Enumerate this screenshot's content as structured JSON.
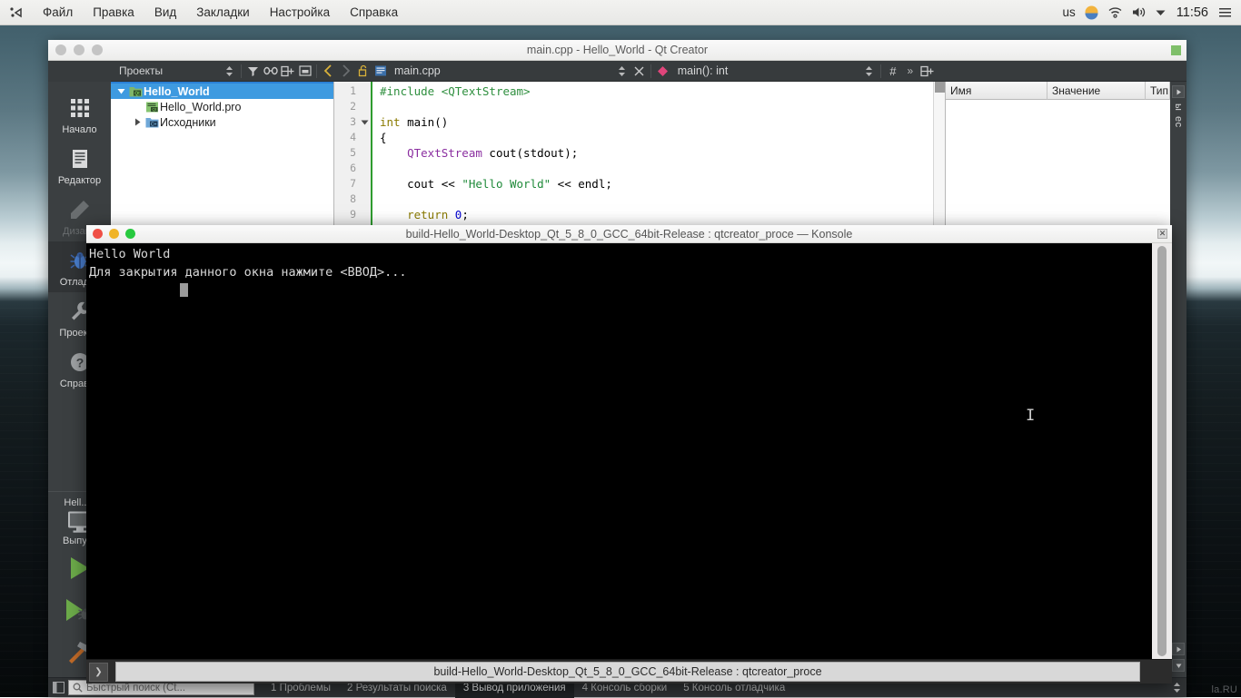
{
  "top_panel": {
    "launcher_icon": "kde-launcher-icon",
    "menus": [
      {
        "label": "Файл",
        "name": "menu-file"
      },
      {
        "label": "Правка",
        "name": "menu-edit"
      },
      {
        "label": "Вид",
        "name": "menu-view"
      },
      {
        "label": "Закладки",
        "name": "menu-bookmarks"
      },
      {
        "label": "Настройка",
        "name": "menu-settings"
      },
      {
        "label": "Справка",
        "name": "menu-help"
      }
    ],
    "tray": {
      "keyboard_layout": "us",
      "weather_icon": "weather-sun-cloud-icon",
      "network_icon": "wifi-icon",
      "volume_icon": "volume-icon",
      "expand_icon": "chevron-down-icon",
      "clock": "11:56",
      "menu_icon": "hamburger-menu-icon"
    }
  },
  "qt_creator": {
    "window_title": "main.cpp - Hello_World - Qt Creator",
    "toolbar": {
      "projects_label": "Проекты",
      "filter_icon": "filter-icon",
      "link_icon": "link-icon",
      "split_icon": "split-add-icon",
      "minimize_icon": "collapse-icon",
      "back_icon": "nav-back-icon",
      "forward_icon": "nav-forward-icon",
      "lock_icon": "unlock-icon",
      "file_type_icon": "cpp-file-icon",
      "filename": "main.cpp",
      "close_icon": "close-icon",
      "symbol_icon": "symbol-diamond-icon",
      "symbol": "main(): int",
      "line_col_icon": "line-number-icon",
      "more_icon": "overflow-icon",
      "split_editor_icon": "split-editor-icon"
    },
    "modes": [
      {
        "label": "Начало",
        "icon": "welcome-grid-icon",
        "name": "mode-welcome",
        "active": false,
        "dim": false
      },
      {
        "label": "Редактор",
        "icon": "edit-document-icon",
        "name": "mode-edit",
        "active": false,
        "dim": false
      },
      {
        "label": "Дизайн",
        "icon": "design-pencil-icon",
        "name": "mode-design",
        "active": false,
        "dim": true
      },
      {
        "label": "Отладка",
        "icon": "debug-bug-icon",
        "name": "mode-debug",
        "active": true,
        "dim": false
      },
      {
        "label": "Проекты",
        "icon": "projects-wrench-icon",
        "name": "mode-projects",
        "active": false,
        "dim": false
      },
      {
        "label": "Справка",
        "icon": "help-question-icon",
        "name": "mode-help",
        "active": false,
        "dim": false
      }
    ],
    "kit": {
      "project_name": "Hell...o",
      "build_config": "Выпуск",
      "target_icon": "desktop-monitor-icon",
      "run_icon": "run-play-icon",
      "debug_icon": "debug-play-icon",
      "build_icon": "build-hammer-icon"
    },
    "project_tree": [
      {
        "label": "Hello_World",
        "icon": "qt-project-icon",
        "indent": 0,
        "selected": true,
        "expander": "expanded"
      },
      {
        "label": "Hello_World.pro",
        "icon": "pro-file-icon",
        "indent": 1,
        "selected": false,
        "expander": "none"
      },
      {
        "label": "Исходники",
        "icon": "sources-folder-icon",
        "indent": 1,
        "selected": false,
        "expander": "collapsed"
      }
    ],
    "editor": {
      "line_numbers": [
        "1",
        "2",
        "3",
        "4",
        "5",
        "6",
        "7",
        "8",
        "9"
      ],
      "code_lines": [
        [
          {
            "t": "#include ",
            "c": "k-pre"
          },
          {
            "t": "<QTextStream>",
            "c": "k-inc"
          }
        ],
        [
          {
            "t": "",
            "c": ""
          }
        ],
        [
          {
            "t": "int",
            "c": "k-type"
          },
          {
            "t": " main()",
            "c": ""
          }
        ],
        [
          {
            "t": "{",
            "c": ""
          }
        ],
        [
          {
            "t": "    QTextStream",
            "c": "k-cls"
          },
          {
            "t": " cout(stdout);",
            "c": ""
          }
        ],
        [
          {
            "t": "",
            "c": ""
          }
        ],
        [
          {
            "t": "    cout << ",
            "c": ""
          },
          {
            "t": "\"Hello World\"",
            "c": "k-str"
          },
          {
            "t": " << endl;",
            "c": ""
          }
        ],
        [
          {
            "t": "",
            "c": ""
          }
        ],
        [
          {
            "t": "    ",
            "c": ""
          },
          {
            "t": "return",
            "c": "k-kw"
          },
          {
            "t": " ",
            "c": ""
          },
          {
            "t": "0",
            "c": "k-num"
          },
          {
            "t": ";",
            "c": ""
          }
        ]
      ]
    },
    "debugger_panel": {
      "columns": [
        "Имя",
        "Значение",
        "Тип"
      ]
    },
    "right_strip": {
      "labels": [
        "ы",
        "ес"
      ],
      "expand_icon": "expand-right-icon",
      "collapse_icon": "collapse-down-icon"
    },
    "status_bar": {
      "sidebar_toggle_icon": "sidebar-toggle-icon",
      "search_icon": "search-icon",
      "search_placeholder": "Быстрый поиск (Ct...",
      "tabs": [
        {
          "label": "1 Проблемы",
          "name": "output-tab-issues",
          "active": false
        },
        {
          "label": "2 Результаты поиска",
          "name": "output-tab-search-results",
          "active": false
        },
        {
          "label": "3 Вывод приложения",
          "name": "output-tab-app-output",
          "active": true
        },
        {
          "label": "4 Консоль сборки",
          "name": "output-tab-build-console",
          "active": false
        },
        {
          "label": "5 Консоль отладчика",
          "name": "output-tab-debugger-console",
          "active": false
        }
      ],
      "end_icon": "updown-arrows-icon"
    }
  },
  "konsole": {
    "window_title": "build-Hello_World-Desktop_Qt_5_8_0_GCC_64bit-Release : qtcreator_proce — Konsole",
    "close_icon": "close-icon",
    "output": "Hello World\nДля закрытия данного окна нажмите <ВВОД>...",
    "cursor": "block-cursor",
    "text_cursor_icon": "i-beam-cursor",
    "tab_arrow_icon": "tab-scroll-right-icon",
    "tab_label": "build-Hello_World-Desktop_Qt_5_8_0_GCC_64bit-Release : qtcreator_proce"
  },
  "desktop": {
    "watermark": "la.RU"
  },
  "colors": {
    "accent_blue": "#3e9ae0",
    "selection_blue": "#2a7fd4",
    "run_green": "#6cab4a",
    "string_green": "#1f8a3a",
    "class_purple": "#8b2fa0",
    "symbol_pink": "#e0457b",
    "panel_dark": "#3b3f41"
  }
}
